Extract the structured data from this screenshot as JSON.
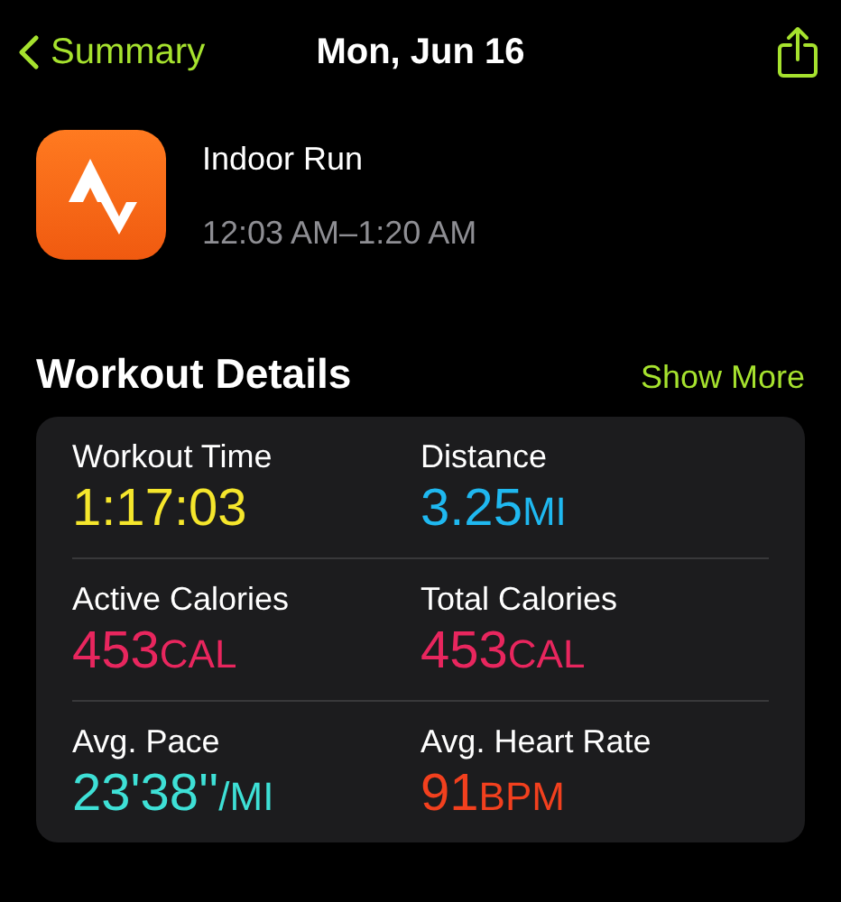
{
  "nav": {
    "back_label": "Summary",
    "title": "Mon, Jun 16"
  },
  "workout": {
    "name": "Indoor Run",
    "time_range": "12:03 AM–1:20 AM"
  },
  "section": {
    "title": "Workout Details",
    "action": "Show More"
  },
  "metrics": [
    {
      "label": "Workout Time",
      "value": "1:17:03",
      "color": "#f5e62c"
    },
    {
      "label": "Distance",
      "value": "3.25",
      "unit": "MI",
      "color": "#1fb8f0"
    },
    {
      "label": "Active Calories",
      "value": "453",
      "unit": "CAL",
      "color": "#e8265e"
    },
    {
      "label": "Total Calories",
      "value": "453",
      "unit": "CAL",
      "color": "#e8265e"
    },
    {
      "label": "Avg. Pace",
      "value": "23'38''",
      "unit": "/MI",
      "color": "#3ee0d6"
    },
    {
      "label": "Avg. Heart Rate",
      "value": "91",
      "unit": "BPM",
      "color": "#f2401e"
    }
  ]
}
